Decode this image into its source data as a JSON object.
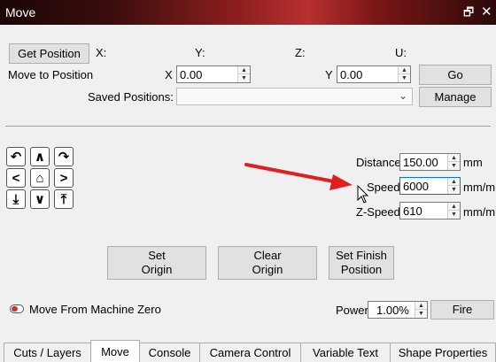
{
  "window": {
    "title": "Move",
    "restore_icon": "restore-window-icon",
    "close_icon": "close-icon"
  },
  "position": {
    "get_position_label": "Get Position",
    "x_label": "X:",
    "y_label": "Y:",
    "z_label": "Z:",
    "u_label": "U:",
    "move_to_label": "Move to Position",
    "x_field_label": "X",
    "x_value": "0.00",
    "y_field_label": "Y",
    "y_value": "0.00",
    "go_label": "Go",
    "saved_label": "Saved Positions:",
    "saved_value": "",
    "manage_label": "Manage"
  },
  "jog": {
    "icons": [
      "rotate-ccw-icon",
      "arrow-up-icon",
      "rotate-cw-icon",
      "arrow-left-icon",
      "home-icon",
      "arrow-right-icon",
      "z-down-icon",
      "arrow-down-icon",
      "z-up-icon"
    ]
  },
  "settings": {
    "distance_label": "Distance",
    "distance_value": "150.00",
    "distance_unit": "mm",
    "speed_label": "Speed",
    "speed_value": "6000",
    "speed_unit": "mm/m",
    "zspeed_label": "Z-Speed",
    "zspeed_value": "610",
    "zspeed_unit": "mm/m"
  },
  "actions": {
    "set_origin_line1": "Set",
    "set_origin_line2": "Origin",
    "clear_origin_line1": "Clear",
    "clear_origin_line2": "Origin",
    "set_finish_line1": "Set Finish",
    "set_finish_line2": "Position"
  },
  "bottom": {
    "move_from_zero_label": "Move From Machine Zero",
    "power_label": "Power",
    "power_value": "1.00%",
    "fire_label": "Fire"
  },
  "tabs": [
    "Cuts / Layers",
    "Move",
    "Console",
    "Camera Control",
    "Variable Text",
    "Shape Properties"
  ],
  "active_tab": "Move",
  "colors": {
    "accent_arrow": "#e02020",
    "focus_border": "#0078d7"
  }
}
